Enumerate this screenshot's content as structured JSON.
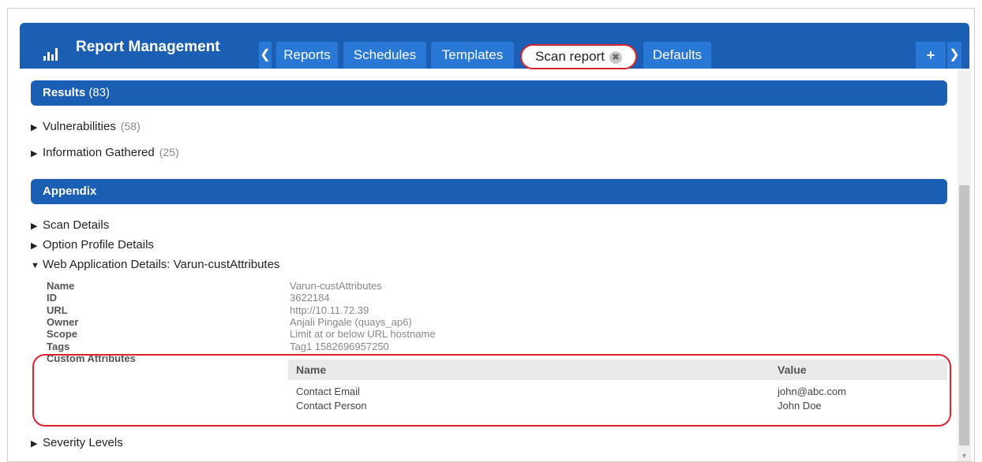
{
  "app": {
    "title": "Report Management"
  },
  "tabs": [
    {
      "label": "Reports"
    },
    {
      "label": "Schedules"
    },
    {
      "label": "Templates"
    },
    {
      "label": "Scan report",
      "active": true
    },
    {
      "label": "Defaults"
    }
  ],
  "nav": {
    "prev_icon": "chevron-left-icon",
    "next_icon": "chevron-right-icon",
    "add_label": "+"
  },
  "results": {
    "title": "Results",
    "count": "(83)",
    "items": [
      {
        "label": "Vulnerabilities",
        "count": "(58)"
      },
      {
        "label": "Information Gathered",
        "count": "(25)"
      }
    ]
  },
  "appendix": {
    "title": "Appendix",
    "items": [
      {
        "label": "Scan Details"
      },
      {
        "label": "Option Profile Details"
      },
      {
        "label": "Web Application Details: Varun-custAttributes",
        "expanded": true
      },
      {
        "label": "Severity Levels"
      }
    ],
    "details": [
      {
        "key": "Name",
        "value": "Varun-custAttributes"
      },
      {
        "key": "ID",
        "value": "3622184"
      },
      {
        "key": "URL",
        "value": "http://10.11.72.39"
      },
      {
        "key": "Owner",
        "value": "Anjali Pingale (quays_ap6)"
      },
      {
        "key": "Scope",
        "value": "Limit at or below URL hostname"
      },
      {
        "key": "Tags",
        "value": "Tag1 1582696957250"
      },
      {
        "key": "Custom Attributes",
        "value": ""
      }
    ],
    "custom_attributes": {
      "headers": {
        "name": "Name",
        "value": "Value"
      },
      "rows": [
        {
          "name": "Contact Email",
          "value": "john@abc.com"
        },
        {
          "name": "Contact Person",
          "value": "John Doe"
        }
      ]
    }
  },
  "colors": {
    "header": "#1a5fb4",
    "tab": "#2a78d6",
    "highlight": "#d9232e"
  }
}
